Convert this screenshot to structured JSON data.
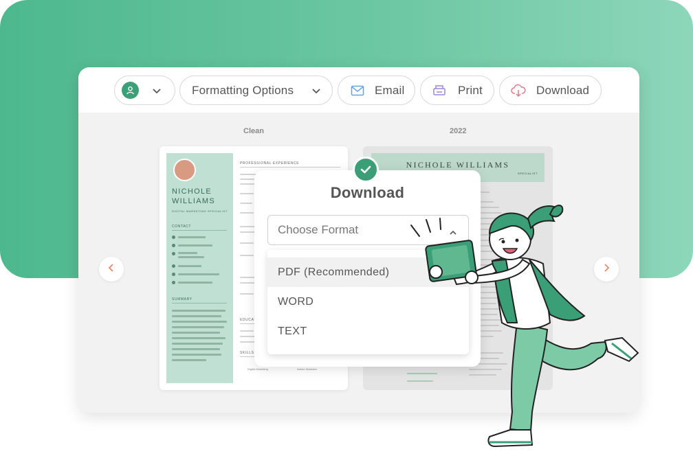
{
  "toolbar": {
    "formatting_label": "Formatting Options",
    "email_label": "Email",
    "print_label": "Print",
    "download_label": "Download"
  },
  "templates": {
    "left_label": "Clean",
    "right_label": "2022"
  },
  "resume_clean": {
    "name": "NICHOLE WILLIAMS",
    "role": "DIGITAL MARKETING SPECIALIST",
    "contact_heading": "CONTACT",
    "summary_heading": "SUMMARY",
    "experience_heading": "PROFESSIONAL EXPERIENCE",
    "education_heading": "EDUCATION",
    "skills_heading": "SKILLS",
    "skill_items": [
      "Digital Marketing",
      "Adobe Illustrator"
    ]
  },
  "resume_2022": {
    "name": "NICHOLE WILLIAMS",
    "role": "SPECIALIST"
  },
  "download_dialog": {
    "title": "Download",
    "select_placeholder": "Choose Format",
    "options": [
      "PDF (Recommended)",
      "WORD",
      "TEXT"
    ],
    "selected_index": 0
  },
  "colors": {
    "brand_green": "#3c9f79",
    "background_green": "#5cbf96",
    "resume_sidebar": "#bfe0d2"
  },
  "icons": {
    "avatar": "user-icon",
    "email": "envelope-icon",
    "print": "printer-icon",
    "download": "cloud-download-icon"
  }
}
